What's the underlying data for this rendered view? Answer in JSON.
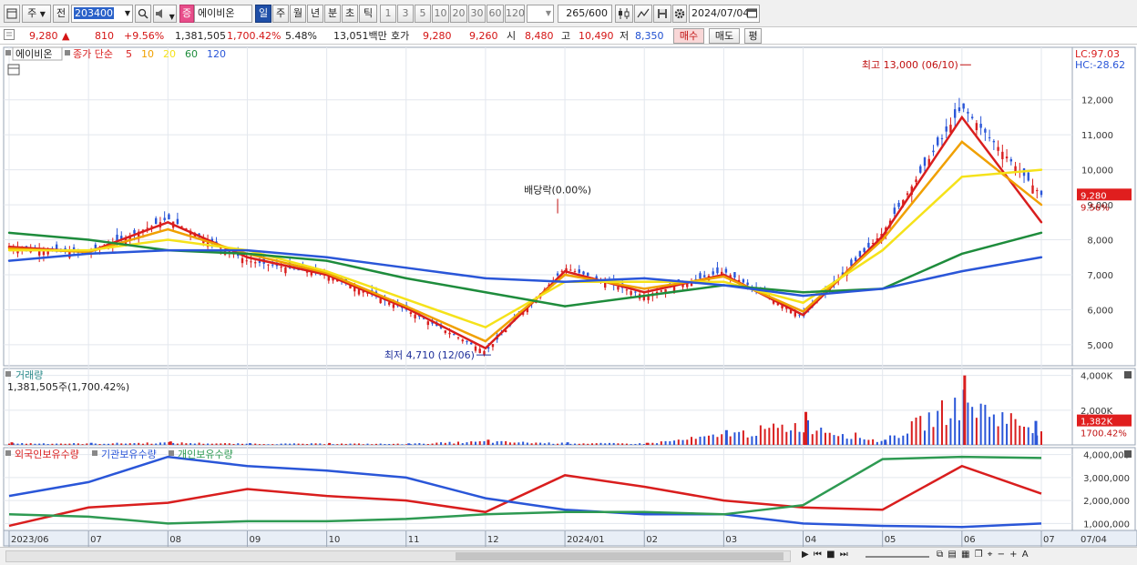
{
  "toolbar": {
    "type_label": "주",
    "period_label": "전",
    "code_value": "203400",
    "search_icon": "search-icon",
    "stock_badge": "증",
    "stock_name": "에이비온",
    "period_tabs": [
      "일",
      "주",
      "월",
      "년",
      "분",
      "초",
      "틱"
    ],
    "interval_buttons": [
      "1",
      "3",
      "5",
      "10",
      "20",
      "30",
      "60",
      "120"
    ],
    "count_value": "265",
    "count_max": "/600",
    "date_value": "2024/07/04"
  },
  "quote": {
    "price": "9,280",
    "arrow": "▲",
    "change": "810",
    "change_pct": "+9.56%",
    "volume": "1,381,505",
    "volume_pct": "1,700.42%",
    "turnover": "5.48%",
    "amount": "13,051백만",
    "hoga_label": "호가",
    "ask": "9,280",
    "bid": "9,260",
    "open_label": "시",
    "open": "8,480",
    "high_label": "고",
    "high": "10,490",
    "low_label": "저",
    "low": "8,350",
    "buy_label": "매수",
    "sell_label": "매도",
    "eval_label": "평"
  },
  "price_panel": {
    "stock_tag": "에이비온",
    "ma_label": "종가 단순",
    "ma_periods": [
      "5",
      "10",
      "20",
      "60",
      "120"
    ],
    "ma_colors": [
      "#d91e1e",
      "#f0a000",
      "#f5e21a",
      "#1e8c3c",
      "#2a56d8"
    ],
    "lc_label": "LC:97.03",
    "hc_label": "HC:-28.62",
    "high_annotation": "최고 13,000 (06/10)",
    "low_annotation": "최저 4,710 (12/06)",
    "dividend_annotation": "배당락(0.00%)",
    "price_tag": "9,280",
    "pct_tag": "9.56%"
  },
  "volume_panel": {
    "title": "거래량",
    "value_text": "1,381,505주(1,700.42%)",
    "tag": "1,382K",
    "pct_tag": "1700.42%"
  },
  "holding_panel": {
    "legend": [
      "외국인보유수량",
      "기관보유수량",
      "개인보유수량"
    ],
    "colors": [
      "#d91e1e",
      "#2a56d8",
      "#2e9a52"
    ]
  },
  "x_axis": {
    "labels": [
      "2023/06",
      "07",
      "08",
      "09",
      "10",
      "11",
      "12",
      "2024/01",
      "02",
      "03",
      "04",
      "05",
      "06",
      "07"
    ],
    "end_label": "07/04"
  },
  "chart_data": [
    {
      "type": "line",
      "title": "에이비온",
      "x": [
        "2023/06",
        "07",
        "08",
        "09",
        "10",
        "11",
        "12",
        "2024/01",
        "02",
        "03",
        "04",
        "05",
        "06",
        "07"
      ],
      "y_ticks": [
        "5,000",
        "6,000",
        "7,000",
        "8,000",
        "9,000",
        "10,000",
        "11,000",
        "12,000"
      ],
      "ylim": [
        4400,
        13500
      ],
      "series": [
        {
          "name": "종가",
          "values": [
            7800,
            7600,
            8600,
            7400,
            7000,
            6000,
            4800,
            7200,
            6400,
            7100,
            5800,
            8200,
            11800,
            9280
          ]
        },
        {
          "name": "5",
          "values": [
            7800,
            7650,
            8500,
            7500,
            7000,
            6050,
            4900,
            7100,
            6500,
            7000,
            5850,
            8100,
            11500,
            8500
          ]
        },
        {
          "name": "10",
          "values": [
            7750,
            7650,
            8300,
            7600,
            7050,
            6100,
            5100,
            7000,
            6600,
            6950,
            5950,
            8000,
            10800,
            9000
          ]
        },
        {
          "name": "20",
          "values": [
            7700,
            7700,
            8000,
            7700,
            7100,
            6300,
            5500,
            6800,
            6800,
            6800,
            6200,
            7700,
            9800,
            10000
          ]
        },
        {
          "name": "60",
          "values": [
            8200,
            8000,
            7700,
            7600,
            7400,
            6900,
            6500,
            6100,
            6400,
            6700,
            6500,
            6600,
            7600,
            8200
          ]
        },
        {
          "name": "120",
          "values": [
            7400,
            7600,
            7700,
            7700,
            7500,
            7200,
            6900,
            6800,
            6900,
            6700,
            6400,
            6600,
            7100,
            7500
          ]
        }
      ]
    },
    {
      "type": "bar",
      "title": "거래량",
      "x": [
        "2023/06",
        "07",
        "08",
        "09",
        "10",
        "11",
        "12",
        "2024/01",
        "02",
        "03",
        "04",
        "05",
        "06",
        "07"
      ],
      "y_ticks": [
        "2,000K",
        "4,000K"
      ],
      "ylim": [
        0,
        4400
      ],
      "values": [
        150,
        120,
        200,
        100,
        110,
        90,
        300,
        150,
        120,
        850,
        1900,
        300,
        4000,
        1382
      ]
    },
    {
      "type": "line",
      "title": "보유수량",
      "x": [
        "2023/06",
        "07",
        "08",
        "09",
        "10",
        "11",
        "12",
        "2024/01",
        "02",
        "03",
        "04",
        "05",
        "06",
        "07"
      ],
      "y_ticks": [
        "1,000,000",
        "2,000,000",
        "3,000,000",
        "4,000,000"
      ],
      "ylim": [
        700000,
        4300000
      ],
      "series": [
        {
          "name": "외국인보유수량",
          "values": [
            900000,
            1700000,
            1900000,
            2500000,
            2200000,
            2000000,
            1500000,
            3100000,
            2600000,
            2000000,
            1700000,
            1600000,
            3500000,
            2300000
          ]
        },
        {
          "name": "기관보유수량",
          "values": [
            2200000,
            2800000,
            3900000,
            3500000,
            3300000,
            3000000,
            2100000,
            1600000,
            1400000,
            1400000,
            1000000,
            900000,
            850000,
            1000000
          ]
        },
        {
          "name": "개인보유수량",
          "values": [
            1400000,
            1300000,
            1000000,
            1100000,
            1100000,
            1200000,
            1400000,
            1500000,
            1500000,
            1400000,
            1800000,
            3800000,
            3900000,
            3850000
          ]
        }
      ]
    }
  ]
}
